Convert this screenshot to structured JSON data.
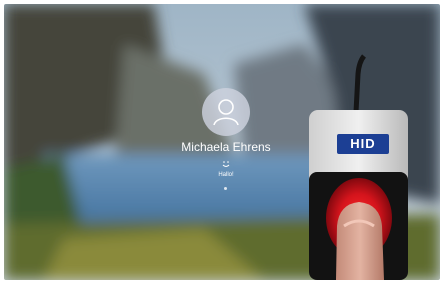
{
  "login": {
    "user_name": "Michaela Ehrens",
    "status": "Hallo!"
  },
  "scanner": {
    "brand": "HID"
  },
  "icons": {
    "avatar": "user-avatar-icon",
    "face": "face-recognition-icon"
  },
  "colors": {
    "accent_red": "#e11d2a",
    "hid_blue": "#1c3f94"
  }
}
